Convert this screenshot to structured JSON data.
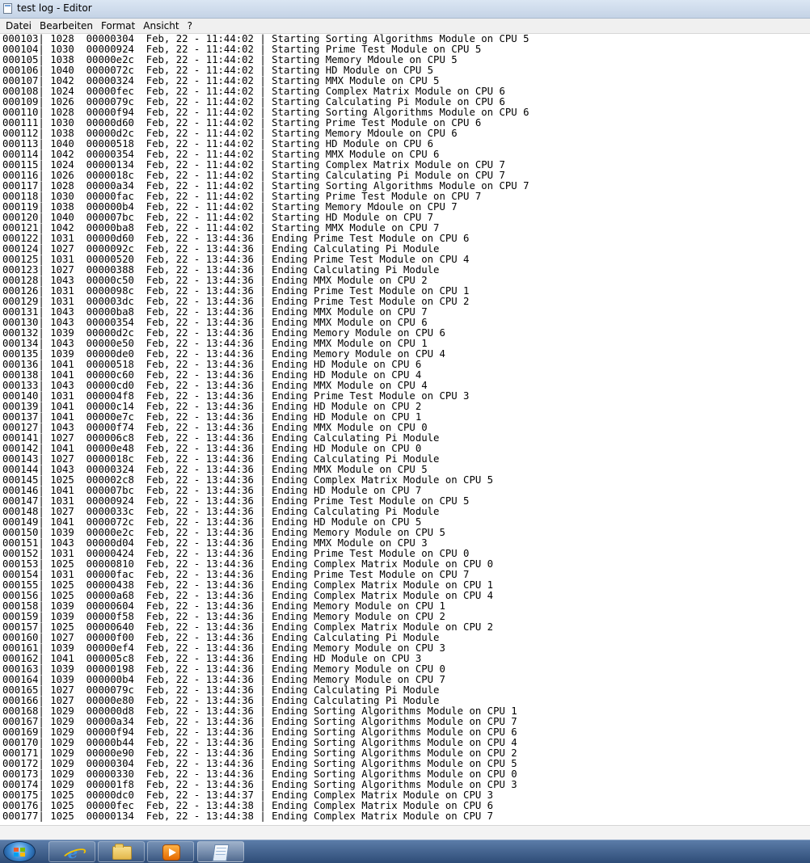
{
  "window": {
    "title": "test log - Editor"
  },
  "menu": [
    "Datei",
    "Bearbeiten",
    "Format",
    "Ansicht",
    "?"
  ],
  "lines": [
    "000103| 1028  00000304  Feb, 22 - 11:44:02 | Starting Sorting Algorithms Module on CPU 5",
    "000104| 1030  00000924  Feb, 22 - 11:44:02 | Starting Prime Test Module on CPU 5",
    "000105| 1038  00000e2c  Feb, 22 - 11:44:02 | Starting Memory Mdoule on CPU 5",
    "000106| 1040  0000072c  Feb, 22 - 11:44:02 | Starting HD Module on CPU 5",
    "000107| 1042  00000324  Feb, 22 - 11:44:02 | Starting MMX Module on CPU 5",
    "000108| 1024  00000fec  Feb, 22 - 11:44:02 | Starting Complex Matrix Module on CPU 6",
    "000109| 1026  0000079c  Feb, 22 - 11:44:02 | Starting Calculating Pi Module on CPU 6",
    "000110| 1028  00000f94  Feb, 22 - 11:44:02 | Starting Sorting Algorithms Module on CPU 6",
    "000111| 1030  00000d60  Feb, 22 - 11:44:02 | Starting Prime Test Module on CPU 6",
    "000112| 1038  00000d2c  Feb, 22 - 11:44:02 | Starting Memory Mdoule on CPU 6",
    "000113| 1040  00000518  Feb, 22 - 11:44:02 | Starting HD Module on CPU 6",
    "000114| 1042  00000354  Feb, 22 - 11:44:02 | Starting MMX Module on CPU 6",
    "000115| 1024  00000134  Feb, 22 - 11:44:02 | Starting Complex Matrix Module on CPU 7",
    "000116| 1026  0000018c  Feb, 22 - 11:44:02 | Starting Calculating Pi Module on CPU 7",
    "000117| 1028  00000a34  Feb, 22 - 11:44:02 | Starting Sorting Algorithms Module on CPU 7",
    "000118| 1030  00000fac  Feb, 22 - 11:44:02 | Starting Prime Test Module on CPU 7",
    "000119| 1038  000000b4  Feb, 22 - 11:44:02 | Starting Memory Mdoule on CPU 7",
    "000120| 1040  000007bc  Feb, 22 - 11:44:02 | Starting HD Module on CPU 7",
    "000121| 1042  00000ba8  Feb, 22 - 11:44:02 | Starting MMX Module on CPU 7",
    "000122| 1031  00000d60  Feb, 22 - 13:44:36 | Ending Prime Test Module on CPU 6",
    "000124| 1027  0000092c  Feb, 22 - 13:44:36 | Ending Calculating Pi Module",
    "000125| 1031  00000520  Feb, 22 - 13:44:36 | Ending Prime Test Module on CPU 4",
    "000123| 1027  00000388  Feb, 22 - 13:44:36 | Ending Calculating Pi Module",
    "000128| 1043  00000c50  Feb, 22 - 13:44:36 | Ending MMX Module on CPU 2",
    "000126| 1031  0000098c  Feb, 22 - 13:44:36 | Ending Prime Test Module on CPU 1",
    "000129| 1031  000003dc  Feb, 22 - 13:44:36 | Ending Prime Test Module on CPU 2",
    "000131| 1043  00000ba8  Feb, 22 - 13:44:36 | Ending MMX Module on CPU 7",
    "000130| 1043  00000354  Feb, 22 - 13:44:36 | Ending MMX Module on CPU 6",
    "000132| 1039  00000d2c  Feb, 22 - 13:44:36 | Ending Memory Module on CPU 6",
    "000134| 1043  00000e50  Feb, 22 - 13:44:36 | Ending MMX Module on CPU 1",
    "000135| 1039  00000de0  Feb, 22 - 13:44:36 | Ending Memory Module on CPU 4",
    "000136| 1041  00000518  Feb, 22 - 13:44:36 | Ending HD Module on CPU 6",
    "000138| 1041  00000c60  Feb, 22 - 13:44:36 | Ending HD Module on CPU 4",
    "000133| 1043  00000cd0  Feb, 22 - 13:44:36 | Ending MMX Module on CPU 4",
    "000140| 1031  000004f8  Feb, 22 - 13:44:36 | Ending Prime Test Module on CPU 3",
    "000139| 1041  00000c14  Feb, 22 - 13:44:36 | Ending HD Module on CPU 2",
    "000137| 1041  00000e7c  Feb, 22 - 13:44:36 | Ending HD Module on CPU 1",
    "000127| 1043  00000f74  Feb, 22 - 13:44:36 | Ending MMX Module on CPU 0",
    "000141| 1027  000006c8  Feb, 22 - 13:44:36 | Ending Calculating Pi Module",
    "000142| 1041  00000e48  Feb, 22 - 13:44:36 | Ending HD Module on CPU 0",
    "000143| 1027  0000018c  Feb, 22 - 13:44:36 | Ending Calculating Pi Module",
    "000144| 1043  00000324  Feb, 22 - 13:44:36 | Ending MMX Module on CPU 5",
    "000145| 1025  000002c8  Feb, 22 - 13:44:36 | Ending Complex Matrix Module on CPU 5",
    "000146| 1041  000007bc  Feb, 22 - 13:44:36 | Ending HD Module on CPU 7",
    "000147| 1031  00000924  Feb, 22 - 13:44:36 | Ending Prime Test Module on CPU 5",
    "000148| 1027  0000033c  Feb, 22 - 13:44:36 | Ending Calculating Pi Module",
    "000149| 1041  0000072c  Feb, 22 - 13:44:36 | Ending HD Module on CPU 5",
    "000150| 1039  00000e2c  Feb, 22 - 13:44:36 | Ending Memory Module on CPU 5",
    "000151| 1043  00000d04  Feb, 22 - 13:44:36 | Ending MMX Module on CPU 3",
    "000152| 1031  00000424  Feb, 22 - 13:44:36 | Ending Prime Test Module on CPU 0",
    "000153| 1025  00000810  Feb, 22 - 13:44:36 | Ending Complex Matrix Module on CPU 0",
    "000154| 1031  00000fac  Feb, 22 - 13:44:36 | Ending Prime Test Module on CPU 7",
    "000155| 1025  00000438  Feb, 22 - 13:44:36 | Ending Complex Matrix Module on CPU 1",
    "000156| 1025  00000a68  Feb, 22 - 13:44:36 | Ending Complex Matrix Module on CPU 4",
    "000158| 1039  00000604  Feb, 22 - 13:44:36 | Ending Memory Module on CPU 1",
    "000159| 1039  00000f58  Feb, 22 - 13:44:36 | Ending Memory Module on CPU 2",
    "000157| 1025  00000640  Feb, 22 - 13:44:36 | Ending Complex Matrix Module on CPU 2",
    "000160| 1027  00000f00  Feb, 22 - 13:44:36 | Ending Calculating Pi Module",
    "000161| 1039  00000ef4  Feb, 22 - 13:44:36 | Ending Memory Module on CPU 3",
    "000162| 1041  000005c8  Feb, 22 - 13:44:36 | Ending HD Module on CPU 3",
    "000163| 1039  00000198  Feb, 22 - 13:44:36 | Ending Memory Module on CPU 0",
    "000164| 1039  000000b4  Feb, 22 - 13:44:36 | Ending Memory Module on CPU 7",
    "000165| 1027  0000079c  Feb, 22 - 13:44:36 | Ending Calculating Pi Module",
    "000166| 1027  00000e80  Feb, 22 - 13:44:36 | Ending Calculating Pi Module",
    "000168| 1029  000000d8  Feb, 22 - 13:44:36 | Ending Sorting Algorithms Module on CPU 1",
    "000167| 1029  00000a34  Feb, 22 - 13:44:36 | Ending Sorting Algorithms Module on CPU 7",
    "000169| 1029  00000f94  Feb, 22 - 13:44:36 | Ending Sorting Algorithms Module on CPU 6",
    "000170| 1029  00000b44  Feb, 22 - 13:44:36 | Ending Sorting Algorithms Module on CPU 4",
    "000171| 1029  00000e90  Feb, 22 - 13:44:36 | Ending Sorting Algorithms Module on CPU 2",
    "000172| 1029  00000304  Feb, 22 - 13:44:36 | Ending Sorting Algorithms Module on CPU 5",
    "000173| 1029  00000330  Feb, 22 - 13:44:36 | Ending Sorting Algorithms Module on CPU 0",
    "000174| 1029  000001f8  Feb, 22 - 13:44:36 | Ending Sorting Algorithms Module on CPU 3",
    "000175| 1025  00000dc0  Feb, 22 - 13:44:37 | Ending Complex Matrix Module on CPU 3",
    "000176| 1025  00000fec  Feb, 22 - 13:44:38 | Ending Complex Matrix Module on CPU 6",
    "000177| 1025  00000134  Feb, 22 - 13:44:38 | Ending Complex Matrix Module on CPU 7"
  ],
  "taskbar": {
    "items": [
      "start-orb-icon",
      "internet-explorer-icon",
      "folder-icon",
      "media-player-icon",
      "notepad-icon"
    ]
  }
}
